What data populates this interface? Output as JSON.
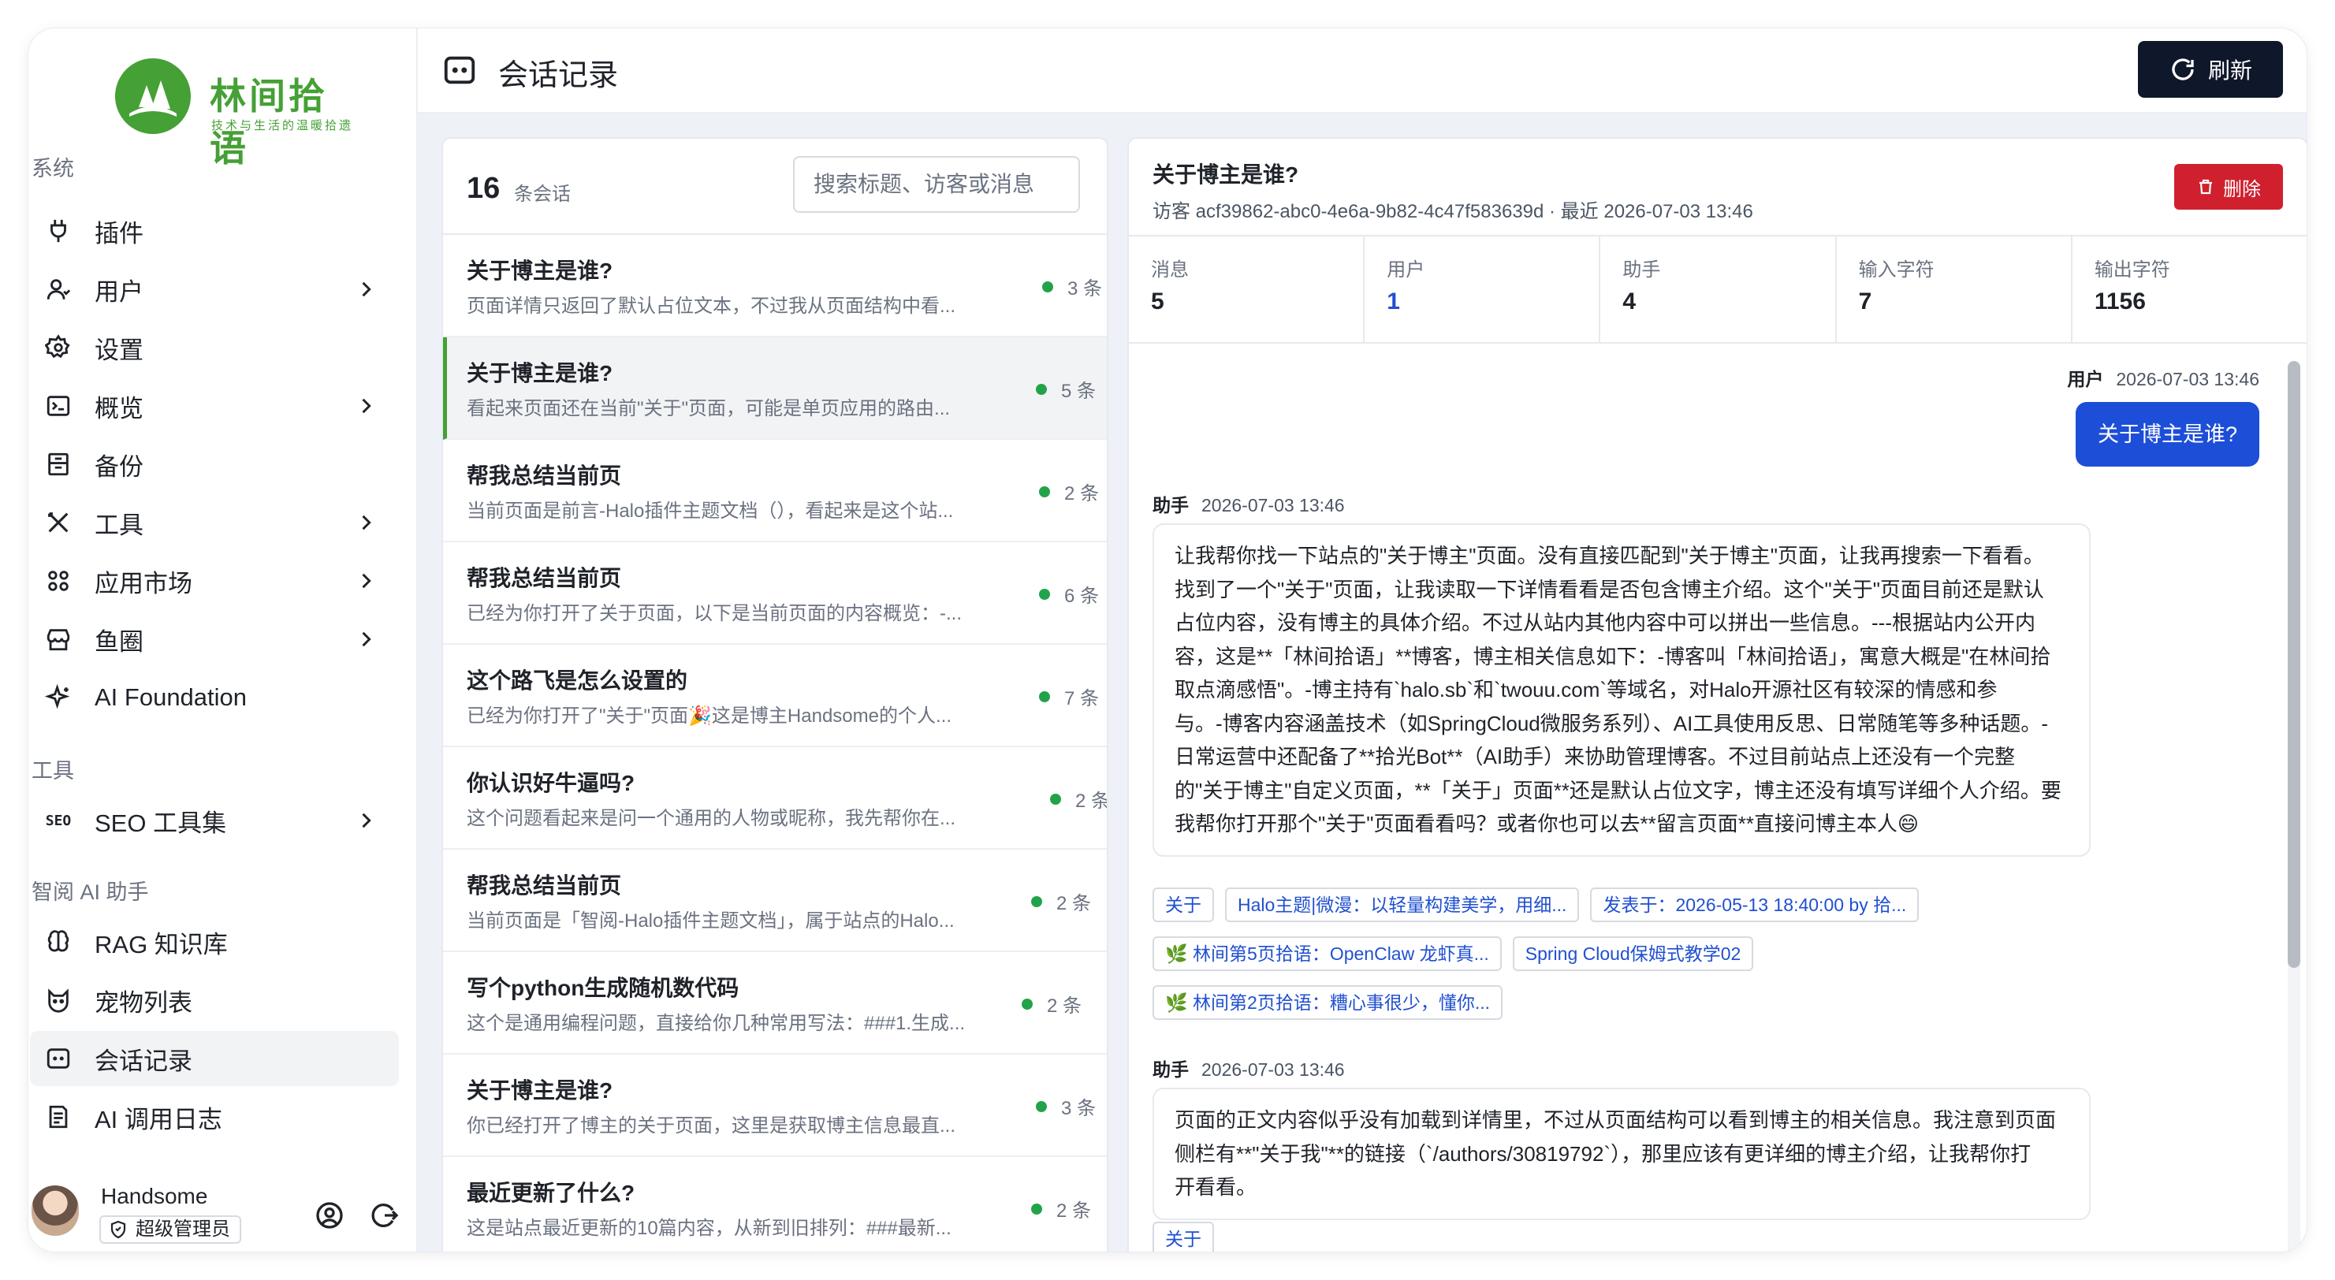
{
  "brand": {
    "title": "林间拾语",
    "subtitle": "技术与生活的温暖拾遗"
  },
  "sidebar": {
    "sections": [
      "系统",
      "工具",
      "智阅 AI 助手"
    ],
    "items": [
      {
        "label": "插件",
        "icon": "plug-icon",
        "chevron": false
      },
      {
        "label": "用户",
        "icon": "user-icon",
        "chevron": true
      },
      {
        "label": "设置",
        "icon": "gear-icon",
        "chevron": false
      },
      {
        "label": "概览",
        "icon": "terminal-icon",
        "chevron": true
      },
      {
        "label": "备份",
        "icon": "archive-icon",
        "chevron": false
      },
      {
        "label": "工具",
        "icon": "tools-icon",
        "chevron": true
      },
      {
        "label": "应用市场",
        "icon": "apps-icon",
        "chevron": true
      },
      {
        "label": "鱼圈",
        "icon": "store-icon",
        "chevron": true
      },
      {
        "label": "AI Foundation",
        "icon": "sparkle-icon",
        "chevron": false
      },
      {
        "label": "SEO 工具集",
        "icon": "seo-icon",
        "chevron": true
      },
      {
        "label": "RAG 知识库",
        "icon": "brain-icon",
        "chevron": false
      },
      {
        "label": "宠物列表",
        "icon": "pet-icon",
        "chevron": false
      },
      {
        "label": "会话记录",
        "icon": "chat-icon",
        "chevron": false
      },
      {
        "label": "AI 调用日志",
        "icon": "log-icon",
        "chevron": false
      }
    ],
    "user": {
      "name": "Handsome",
      "role": "超级管理员"
    }
  },
  "header": {
    "title": "会话记录",
    "refresh_label": "刷新"
  },
  "list": {
    "count": "16",
    "count_label": "条会话",
    "search_placeholder": "搜索标题、访客或消息",
    "items": [
      {
        "title": "关于博主是谁?",
        "preview": "页面详情只返回了默认占位文本，不过我从页面结构中看...",
        "count": "3 条"
      },
      {
        "title": "关于博主是谁?",
        "preview": "看起来页面还在当前\"关于\"页面，可能是单页应用的路由...",
        "count": "5 条"
      },
      {
        "title": "帮我总结当前页",
        "preview": "当前页面是前言-Halo插件主题文档（），看起来是这个站...",
        "count": "2 条"
      },
      {
        "title": "帮我总结当前页",
        "preview": "已经为你打开了关于页面，以下是当前页面的内容概览：-...",
        "count": "6 条"
      },
      {
        "title": "这个路飞是怎么设置的",
        "preview": "已经为你打开了\"关于\"页面🎉这是博主Handsome的个人...",
        "count": "7 条"
      },
      {
        "title": "你认识好牛逼吗?",
        "preview": "这个问题看起来是问一个通用的人物或昵称，我先帮你在...",
        "count": "2 条"
      },
      {
        "title": "帮我总结当前页",
        "preview": "当前页面是「智阅-Halo插件主题文档」，属于站点的Halo...",
        "count": "2 条"
      },
      {
        "title": "写个python生成随机数代码",
        "preview": "这个是通用编程问题，直接给你几种常用写法：###1.生成...",
        "count": "2 条"
      },
      {
        "title": "关于博主是谁?",
        "preview": "你已经打开了博主的关于页面，这里是获取博主信息最直...",
        "count": "3 条"
      },
      {
        "title": "最近更新了什么?",
        "preview": "这是站点最近更新的10篇内容，从新到旧排列：###最新...",
        "count": "2 条"
      }
    ]
  },
  "detail": {
    "title": "关于博主是谁?",
    "meta": "访客 acf39862-abc0-4e6a-9b82-4c47f583639d · 最近 2026-07-03 13:46",
    "delete_label": "删除",
    "stats": [
      {
        "label": "消息",
        "value": "5"
      },
      {
        "label": "用户",
        "value": "1"
      },
      {
        "label": "助手",
        "value": "4"
      },
      {
        "label": "输入字符",
        "value": "7"
      },
      {
        "label": "输出字符",
        "value": "1156"
      }
    ],
    "user_msg": {
      "role": "用户",
      "time": "2026-07-03 13:46",
      "text": "关于博主是谁?"
    },
    "assistant_msg1": {
      "role": "助手",
      "time": "2026-07-03 13:46",
      "lines": [
        "让我帮你找一下站点的\"关于博主\"页面。没有直接匹配到\"关于博主\"页面，让我再搜索一下看看。",
        "找到了一个\"关于\"页面，让我读取一下详情看看是否包含博主介绍。这个\"关于\"页面目前还是默认",
        "占位内容，没有博主的具体介绍。不过从站内其他内容中可以拼出一些信息。---根据站内公开内",
        "容，这是**「林间拾语」**博客，博主相关信息如下：-博客叫「林间拾语」，寓意大概是\"在林间拾",
        "取点滴感悟\"。-博主持有`halo.sb`和`twouu.com`等域名，对Halo开源社区有较深的情感和参",
        "与。-博客内容涵盖技术（如SpringCloud微服务系列）、AI工具使用反思、日常随笔等多种话题。-",
        "日常运营中还配备了**拾光Bot**（AI助手）来协助管理博客。不过目前站点上还没有一个完整",
        "的\"关于博主\"自定义页面，**「关于」页面**还是默认占位文字，博主还没有填写详细个人介绍。要",
        "我帮你打开那个\"关于\"页面看看吗？或者你也可以去**留言页面**直接问博主本人😄"
      ]
    },
    "chips_row1": [
      "关于",
      "Halo主题|微漫：以轻量构建美学，用细...",
      "发表于：2026-05-13 18:40:00 by 拾..."
    ],
    "chips_row2": [
      "🌿 林间第5页拾语：OpenClaw 龙虾真...",
      "Spring Cloud保姆式教学02"
    ],
    "chips_row3": [
      "🌿 林间第2页拾语：糟心事很少，懂你..."
    ],
    "assistant_msg2": {
      "role": "助手",
      "time": "2026-07-03 13:46",
      "lines": [
        "页面的正文内容似乎没有加载到详情里，不过从页面结构可以看到博主的相关信息。我注意到页面",
        "侧栏有**\"关于我\"**的链接（`/authors/30819792`），那里应该有更详细的博主介绍，让我帮你打",
        "开看看。"
      ]
    },
    "chips_row4": [
      "关于"
    ]
  }
}
